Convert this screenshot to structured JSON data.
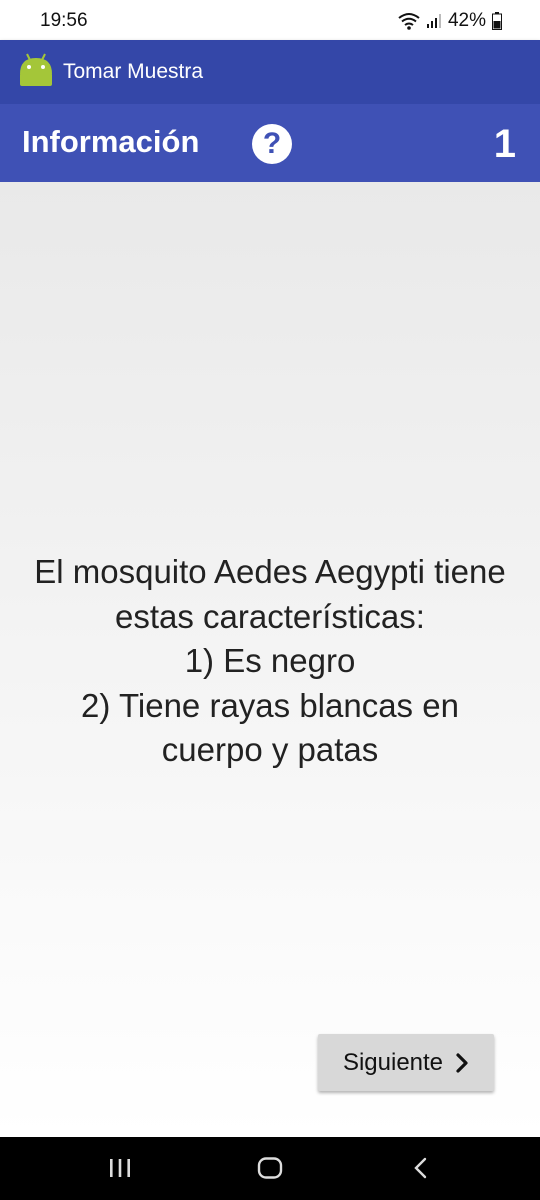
{
  "status_bar": {
    "time": "19:56",
    "battery": "42%"
  },
  "app_bar": {
    "title": "Tomar Muestra",
    "logo_icon": "android-icon"
  },
  "info_bar": {
    "label": "Información",
    "help_icon": "help-icon",
    "help_symbol": "?",
    "step_number": "1"
  },
  "main": {
    "message": "El mosquito Aedes Aegypti tiene\nestas características:\n1) Es negro\n 2) Tiene rayas blancas en\ncuerpo y patas"
  },
  "buttons": {
    "next_label": "Siguiente",
    "next_icon": "chevron-right-icon"
  },
  "nav_bar": {
    "recents_icon": "recents-icon",
    "home_icon": "home-icon",
    "back_icon": "back-icon"
  },
  "colors": {
    "app_bar": "#3447a8",
    "info_bar": "#3f51b5",
    "button": "#d8d8d8"
  }
}
